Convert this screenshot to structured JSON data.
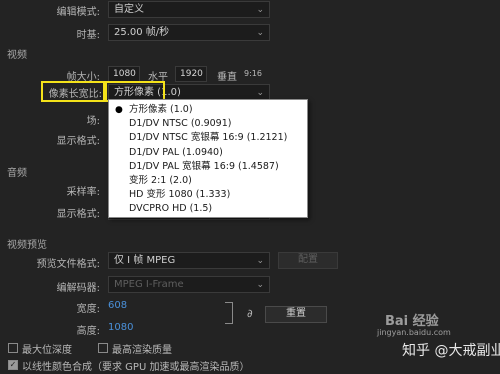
{
  "general": {
    "editing_mode_label": "编辑模式:",
    "editing_mode_value": "自定义",
    "timebase_label": "时基:",
    "timebase_value": "25.00 帧/秒"
  },
  "video": {
    "section": "视频",
    "frame_size_label": "帧大小:",
    "frame_width": "1080",
    "horizontal_label": "水平",
    "frame_height": "1920",
    "vertical_label": "垂直",
    "aspect": "9:16",
    "pixel_aspect_label": "像素长宽比:",
    "pixel_aspect_value": "方形像素 (1.0)",
    "fields_label": "场:",
    "display_format_label": "显示格式:",
    "pixel_aspect_options": [
      {
        "label": "方形像素 (1.0)",
        "selected": true
      },
      {
        "label": "D1/DV NTSC (0.9091)",
        "selected": false
      },
      {
        "label": "D1/DV NTSC 宽银幕 16:9 (1.2121)",
        "selected": false
      },
      {
        "label": "D1/DV PAL (1.0940)",
        "selected": false
      },
      {
        "label": "D1/DV PAL 宽银幕 16:9 (1.4587)",
        "selected": false
      },
      {
        "label": "变形 2:1 (2.0)",
        "selected": false
      },
      {
        "label": "HD 变形 1080 (1.333)",
        "selected": false
      },
      {
        "label": "DVCPRO HD (1.5)",
        "selected": false
      }
    ]
  },
  "audio": {
    "section": "音频",
    "sample_rate_label": "采样率:",
    "display_format_label": "显示格式:"
  },
  "preview": {
    "section": "视频预览",
    "file_format_label": "预览文件格式:",
    "file_format_value": "仅 I 帧 MPEG",
    "configure_button": "配置",
    "codec_label": "编解码器:",
    "codec_value": "MPEG I-Frame",
    "width_label": "宽度:",
    "width_value": "608",
    "height_label": "高度:",
    "height_value": "1080",
    "reset_button": "重置"
  },
  "options": {
    "max_bit_depth": "最大位深度",
    "max_render_quality": "最高渲染质量",
    "linear_color": "以线性颜色合成（要求 GPU 加速或最高渲染品质）"
  },
  "watermark": {
    "zhihu": "知乎 @大戒副业",
    "baidu": "Bai 经验",
    "url": "jingyan.baidu.com"
  },
  "colors": {
    "highlight": "#f4e21a",
    "link_blue": "#4a90d9",
    "panel_bg": "#232323"
  }
}
